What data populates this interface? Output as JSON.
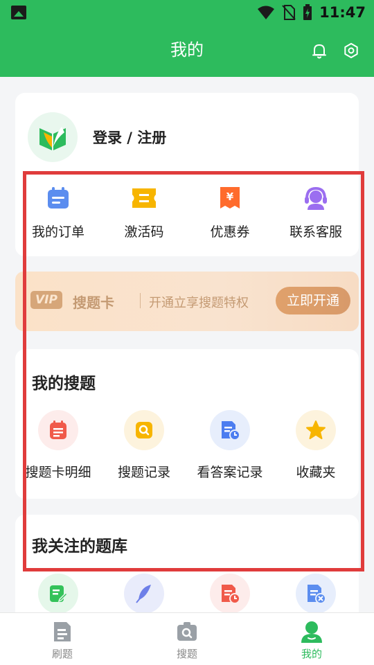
{
  "status_bar": {
    "time": "11:47"
  },
  "header": {
    "title": "我的"
  },
  "profile": {
    "login_label": "登录 / 注册"
  },
  "quick_actions": [
    {
      "label": "我的订单",
      "icon": "calendar-icon",
      "color": "#5b8def"
    },
    {
      "label": "激活码",
      "icon": "ticket-icon",
      "color": "#f7b500"
    },
    {
      "label": "优惠券",
      "icon": "coupon-yen-icon",
      "color": "#ff6b2c"
    },
    {
      "label": "联系客服",
      "icon": "headset-service-icon",
      "color": "#9b6ef0"
    }
  ],
  "vip_banner": {
    "badge": "VIP",
    "name": "搜题卡",
    "description": "开通立享搜题特权",
    "button": "立即开通"
  },
  "my_search": {
    "title": "我的搜题",
    "items": [
      {
        "label": "搜题卡明细",
        "icon": "calendar-list-icon",
        "color": "#f05a4a",
        "bg": "#fdeceb"
      },
      {
        "label": "搜题记录",
        "icon": "search-doc-icon",
        "color": "#f7b500",
        "bg": "#fdf3dd"
      },
      {
        "label": "看答案记录",
        "icon": "doc-clock-icon",
        "color": "#4c7df0",
        "bg": "#e7eefc"
      },
      {
        "label": "收藏夹",
        "icon": "star-icon",
        "color": "#f7b500",
        "bg": "#fdf3dd"
      }
    ]
  },
  "followed_banks": {
    "title": "我关注的题库",
    "items": [
      {
        "icon": "edit-note-icon",
        "color": "#34c25a",
        "bg": "#e5f7ea"
      },
      {
        "icon": "feather-icon",
        "color": "#6d7fe8",
        "bg": "#e9ecfb"
      },
      {
        "icon": "doc-clock-icon",
        "color": "#f05a4a",
        "bg": "#fdeceb"
      },
      {
        "icon": "doc-cancel-icon",
        "color": "#5b8def",
        "bg": "#e7eefc"
      }
    ]
  },
  "tabbar": [
    {
      "label": "刷题",
      "icon": "practice-doc-icon"
    },
    {
      "label": "搜题",
      "icon": "search-camera-icon"
    },
    {
      "label": "我的",
      "icon": "person-icon",
      "active": true
    }
  ],
  "colors": {
    "brand": "#2dbb5d",
    "highlight": "#e03c3c"
  }
}
